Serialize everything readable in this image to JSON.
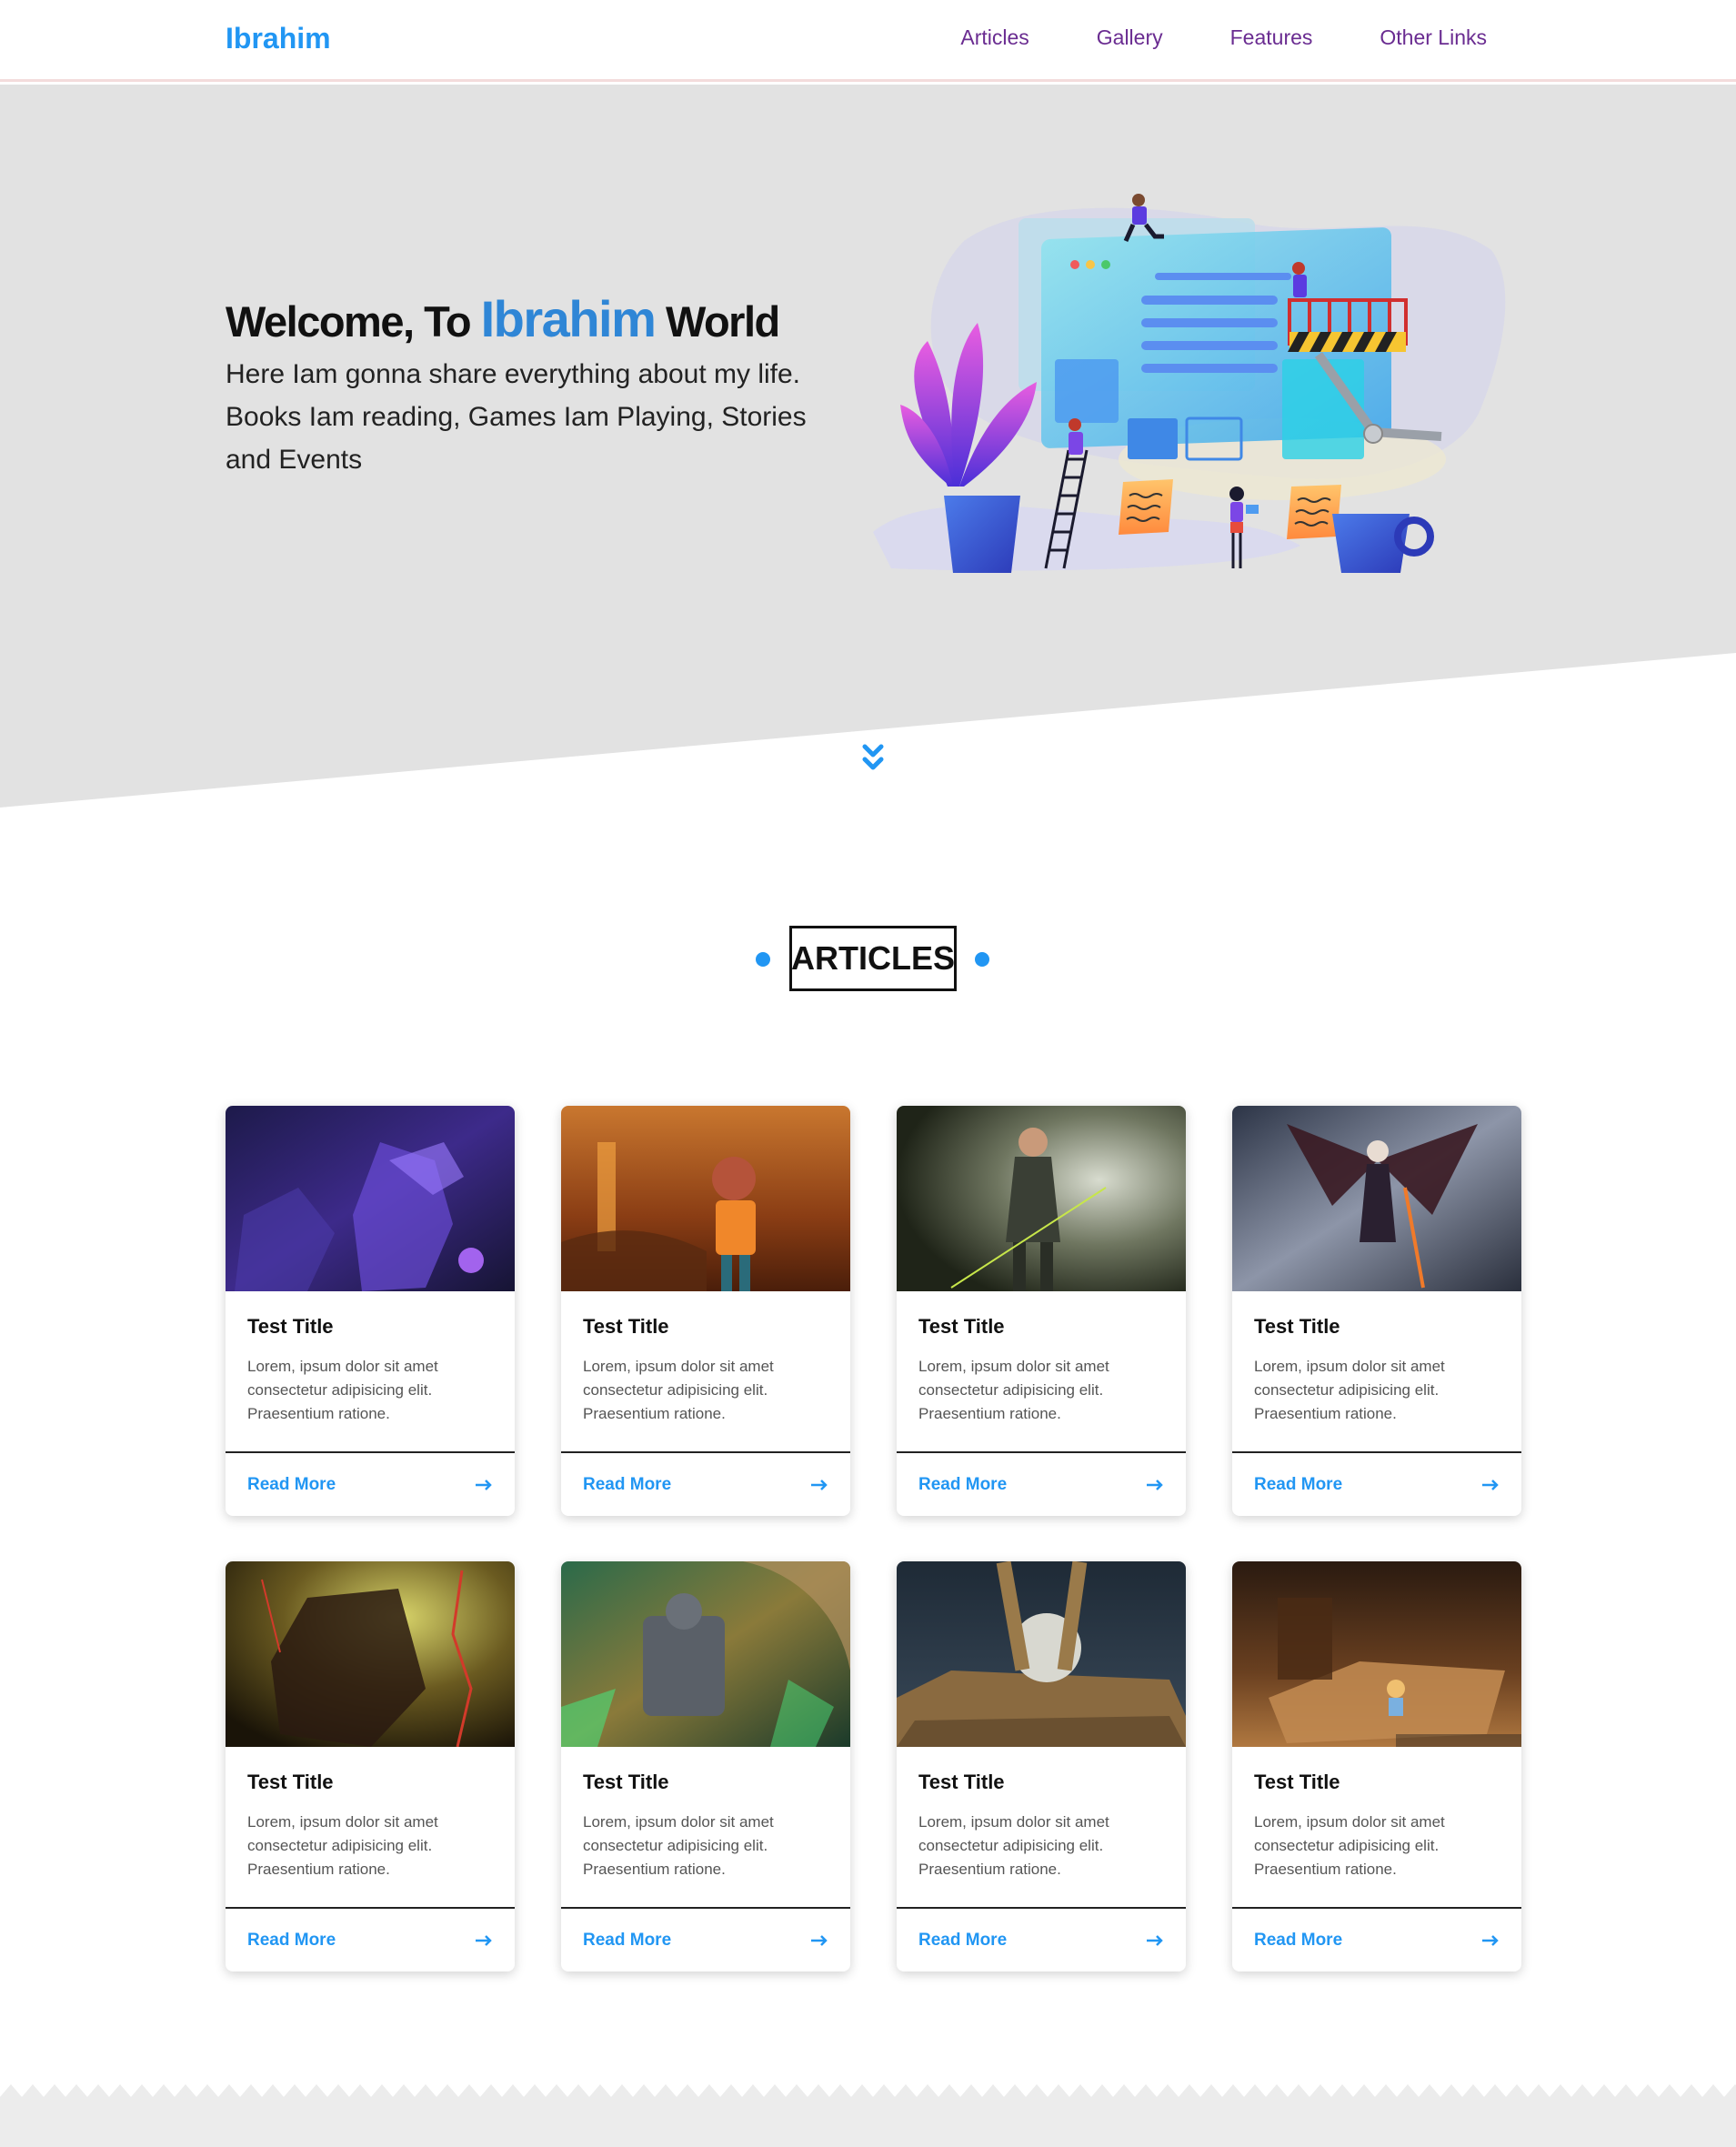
{
  "header": {
    "logo": "Ibrahim",
    "nav": [
      "Articles",
      "Gallery",
      "Features",
      "Other Links"
    ]
  },
  "hero": {
    "title_prefix": "Welcome, To",
    "title_brand": "Ibrahim",
    "title_suffix": "World",
    "text": "Here Iam gonna share everything about my life. Books Iam reading, Games Iam Playing, Stories and Events"
  },
  "articles": {
    "heading": "ARTICLES",
    "cards": [
      {
        "title": "Test Title",
        "description": "Lorem, ipsum dolor sit amet consectetur adipisicing elit. Praesentium ratione.",
        "link": "Read More"
      },
      {
        "title": "Test Title",
        "description": "Lorem, ipsum dolor sit amet consectetur adipisicing elit. Praesentium ratione.",
        "link": "Read More"
      },
      {
        "title": "Test Title",
        "description": "Lorem, ipsum dolor sit amet consectetur adipisicing elit. Praesentium ratione.",
        "link": "Read More"
      },
      {
        "title": "Test Title",
        "description": "Lorem, ipsum dolor sit amet consectetur adipisicing elit. Praesentium ratione.",
        "link": "Read More"
      },
      {
        "title": "Test Title",
        "description": "Lorem, ipsum dolor sit amet consectetur adipisicing elit. Praesentium ratione.",
        "link": "Read More"
      },
      {
        "title": "Test Title",
        "description": "Lorem, ipsum dolor sit amet consectetur adipisicing elit. Praesentium ratione.",
        "link": "Read More"
      },
      {
        "title": "Test Title",
        "description": "Lorem, ipsum dolor sit amet consectetur adipisicing elit. Praesentium ratione.",
        "link": "Read More"
      },
      {
        "title": "Test Title",
        "description": "Lorem, ipsum dolor sit amet consectetur adipisicing elit. Praesentium ratione.",
        "link": "Read More"
      }
    ]
  },
  "colors": {
    "accent": "#2196f3",
    "nav_link": "#6a2c91",
    "hero_bg": "#e2e2e2"
  },
  "icons": {
    "scroll_down": "double-chevron-down-icon",
    "card_link": "arrow-right-icon"
  }
}
